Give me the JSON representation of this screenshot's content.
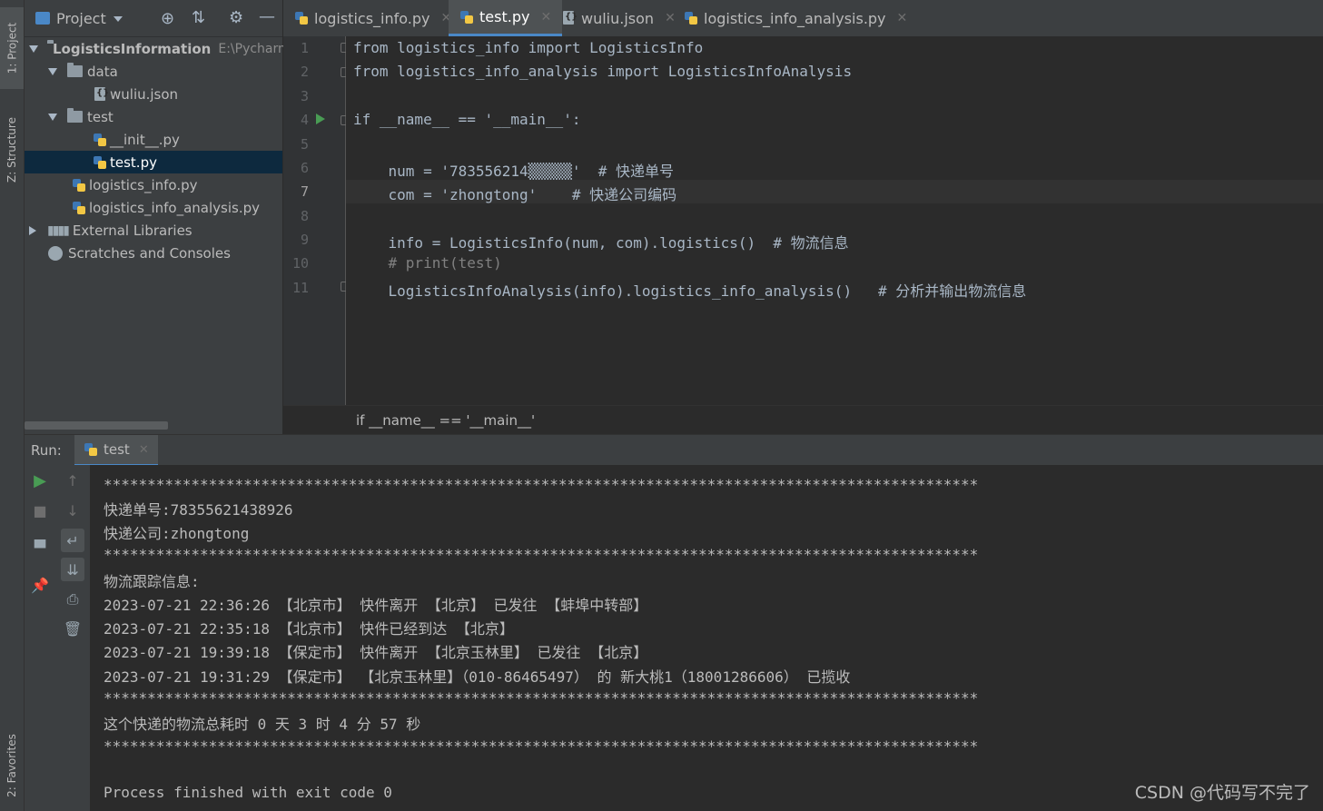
{
  "left_strip": {
    "project_tab": "1: Project",
    "structure_tab": "Z: Structure",
    "favorites_tab": "2: Favorites"
  },
  "project_panel": {
    "title": "Project",
    "tree": [
      {
        "label": "LogisticsInformation",
        "hint": "E:\\Pycharm",
        "kind": "folder",
        "expanded": true
      },
      {
        "label": "data",
        "kind": "folder",
        "expanded": true
      },
      {
        "label": "wuliu.json",
        "kind": "json"
      },
      {
        "label": "test",
        "kind": "folder",
        "expanded": true
      },
      {
        "label": "__init__.py",
        "kind": "py"
      },
      {
        "label": "test.py",
        "kind": "py",
        "selected": true
      },
      {
        "label": "logistics_info.py",
        "kind": "py"
      },
      {
        "label": "logistics_info_analysis.py",
        "kind": "py"
      },
      {
        "label": "External Libraries",
        "kind": "lib",
        "expanded": false
      },
      {
        "label": "Scratches and Consoles",
        "kind": "scratch"
      }
    ]
  },
  "tabs": [
    {
      "label": "logistics_info.py",
      "active": false
    },
    {
      "label": "test.py",
      "active": true
    },
    {
      "label": "wuliu.json",
      "active": false
    },
    {
      "label": "logistics_info_analysis.py",
      "active": false
    }
  ],
  "editor": {
    "lines": [
      {
        "n": "1",
        "text": "from logistics_info import LogisticsInfo"
      },
      {
        "n": "2",
        "text": "from logistics_info_analysis import LogisticsInfoAnalysis"
      },
      {
        "n": "3",
        "text": ""
      },
      {
        "n": "4",
        "text": "if __name__ == '__main__':"
      },
      {
        "n": "5",
        "text": ""
      },
      {
        "n": "6",
        "text": "    num = '783556214▒▒▒▒▒'  # 快递单号"
      },
      {
        "n": "7",
        "text": "    com = 'zhongtong'    # 快递公司编码"
      },
      {
        "n": "8",
        "text": ""
      },
      {
        "n": "9",
        "text": "    info = LogisticsInfo(num, com).logistics()  # 物流信息"
      },
      {
        "n": "10",
        "text": "    # print(test)"
      },
      {
        "n": "11",
        "text": "    LogisticsInfoAnalysis(info).logistics_info_analysis()   # 分析并输出物流信息"
      }
    ],
    "breadcrumb": "if __name__ == '__main__'"
  },
  "run": {
    "label": "Run:",
    "tab": "test",
    "output": [
      "****************************************************************************************************",
      "快递单号:78355621438926",
      "快递公司:zhongtong",
      "****************************************************************************************************",
      "物流跟踪信息:",
      "2023-07-21 22:36:26 【北京市】 快件离开 【北京】 已发往 【蚌埠中转部】",
      "2023-07-21 22:35:18 【北京市】 快件已经到达 【北京】",
      "2023-07-21 19:39:18 【保定市】 快件离开 【北京玉林里】 已发往 【北京】",
      "2023-07-21 19:31:29 【保定市】 【北京玉林里】（010-86465497） 的 新大桃1（18001286606） 已揽收",
      "****************************************************************************************************",
      "这个快递的物流总耗时 0 天 3 时 4 分 57 秒",
      "****************************************************************************************************",
      "",
      "Process finished with exit code 0"
    ]
  },
  "watermark": "CSDN @代码写不完了",
  "colors": {
    "keyword": "#cc7832",
    "string": "#6a8759",
    "comment": "#808080",
    "run_green": "#499c54",
    "selection": "#0d293e",
    "accent": "#4a88c7"
  }
}
